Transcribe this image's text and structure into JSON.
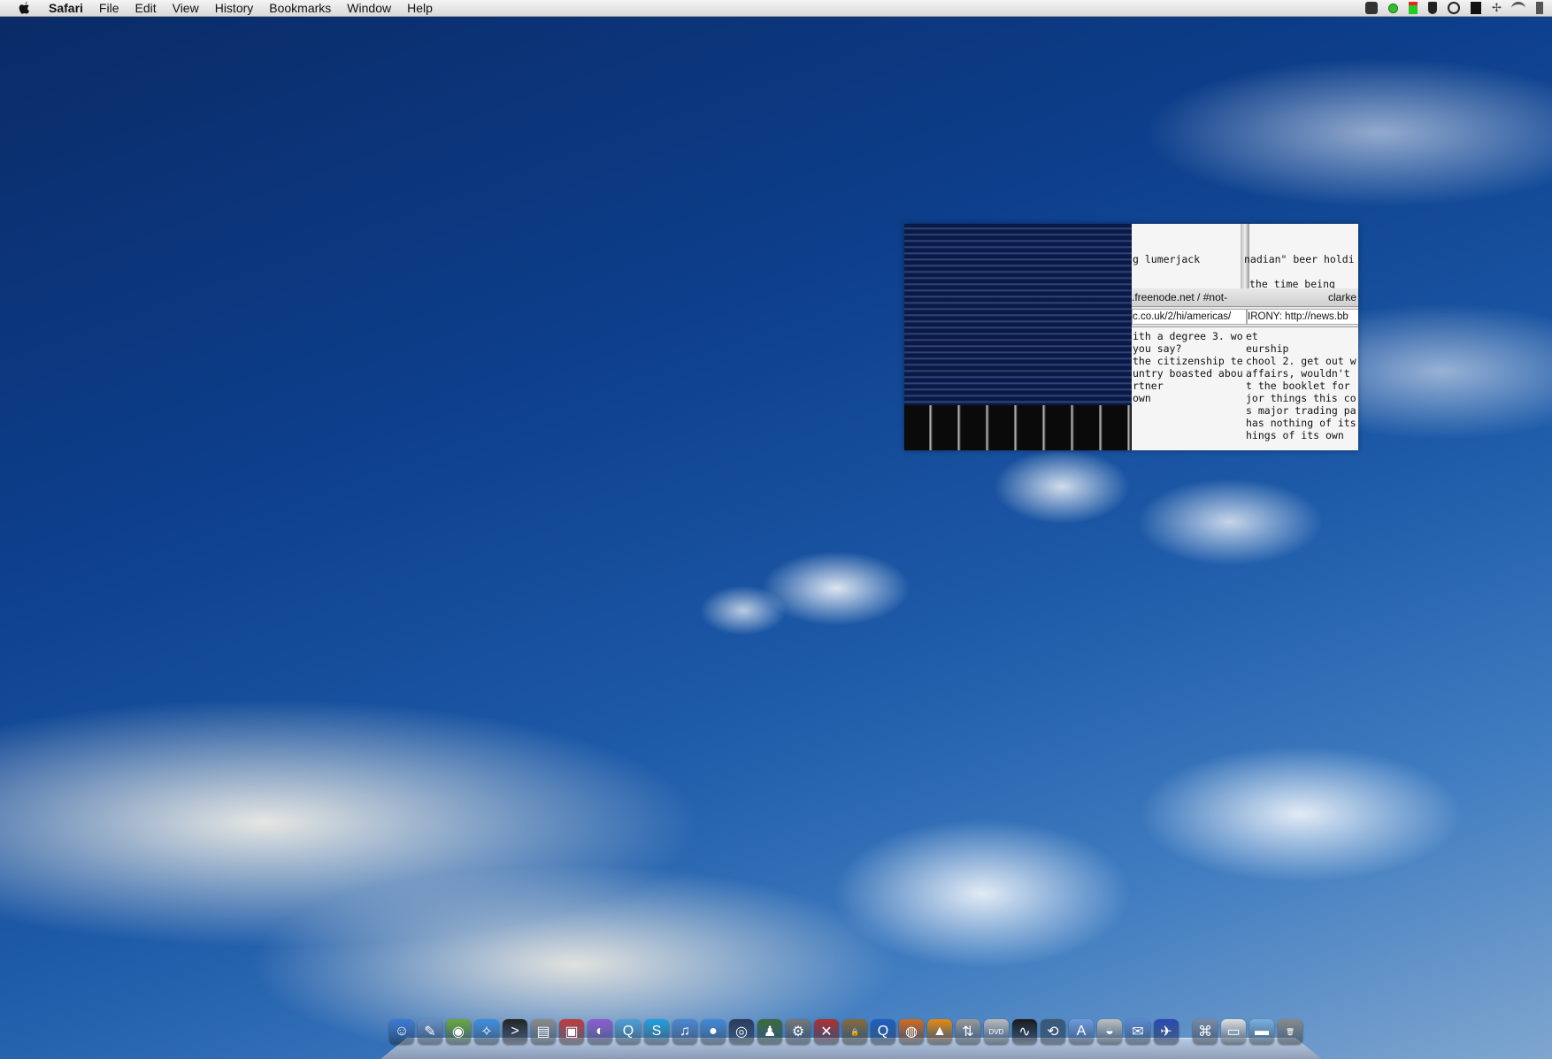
{
  "menubar": {
    "app_name": "Safari",
    "items": [
      "File",
      "Edit",
      "View",
      "History",
      "Bookmarks",
      "Window",
      "Help"
    ]
  },
  "status_icons": [
    "growl-icon",
    "green-dot-icon",
    "cpu-meter-icon",
    "plug-icon",
    "sync-icon",
    "clock-icon",
    "bluetooth-icon",
    "wifi-icon",
    "volume-icon"
  ],
  "fragment": {
    "terminal_lines_top": [
      "g lumerjack",
      "nadian\" beer holdi",
      "the time being"
    ],
    "tab_title_left": ".freenode.net / #not-",
    "tab_title_right": "clarke",
    "url_left": "c.co.uk/2/hi/americas/",
    "url_right": "IRONY: http://news.bb",
    "chat_left": [
      "",
      "",
      "ith a degree 3. wo",
      "you say?",
      "",
      "the citizenship te",
      "untry boasted abou",
      "rtner",
      "own"
    ],
    "chat_right": [
      "et",
      "eurship",
      "chool 2. get out w",
      "affairs, wouldn't",
      "",
      "t the booklet for",
      "jor things this co",
      "s major trading pa",
      "has nothing of its",
      "hings of its own"
    ]
  },
  "dock": {
    "apps": [
      {
        "name": "finder",
        "color": "#3b7bd6",
        "glyph": "☺"
      },
      {
        "name": "preview",
        "color": "#6a8fc4",
        "glyph": "✎"
      },
      {
        "name": "netnewswire",
        "color": "#6aa83a",
        "glyph": "◉"
      },
      {
        "name": "safari",
        "color": "#3d8fe0",
        "glyph": "✧"
      },
      {
        "name": "terminal",
        "color": "#222222",
        "glyph": ">"
      },
      {
        "name": "file-merge",
        "color": "#8a8a8a",
        "glyph": "▤"
      },
      {
        "name": "photo-booth",
        "color": "#c23a3a",
        "glyph": "▣"
      },
      {
        "name": "colloquy",
        "color": "#8c5bd6",
        "glyph": "◐"
      },
      {
        "name": "quicksilver",
        "color": "#4aa0d8",
        "glyph": "Q"
      },
      {
        "name": "skype",
        "color": "#1ea0e0",
        "glyph": "S"
      },
      {
        "name": "itunes",
        "color": "#4b86d2",
        "glyph": "♫"
      },
      {
        "name": "ichat",
        "color": "#3f8ad8",
        "glyph": "●"
      },
      {
        "name": "dashboard",
        "color": "#2a3a5a",
        "glyph": "◎"
      },
      {
        "name": "vlc-character",
        "color": "#3a6a3a",
        "glyph": "♟"
      },
      {
        "name": "system-preferences",
        "color": "#777777",
        "glyph": "⚙"
      },
      {
        "name": "x11",
        "color": "#b03030",
        "glyph": "✕"
      },
      {
        "name": "keychain",
        "color": "#8a6a3a",
        "glyph": "🔒"
      },
      {
        "name": "quicktime",
        "color": "#2060c0",
        "glyph": "Q"
      },
      {
        "name": "firefox",
        "color": "#d86a1a",
        "glyph": "◍"
      },
      {
        "name": "vlc",
        "color": "#e88a10",
        "glyph": "▲"
      },
      {
        "name": "transmission",
        "color": "#9a9a9a",
        "glyph": "⇅"
      },
      {
        "name": "dvd-player",
        "color": "#bbbbbb",
        "glyph": "DVD"
      },
      {
        "name": "activity-monitor",
        "color": "#1a1a1a",
        "glyph": "∿"
      },
      {
        "name": "time-machine",
        "color": "#3a5a7a",
        "glyph": "⟲"
      },
      {
        "name": "app-store-box",
        "color": "#6f9be0",
        "glyph": "A"
      },
      {
        "name": "cd-burner",
        "color": "#c0c0c0",
        "glyph": "◒"
      },
      {
        "name": "mail",
        "color": "#5a8ad0",
        "glyph": "✉"
      },
      {
        "name": "airplane",
        "color": "#2a4ab0",
        "glyph": "✈"
      }
    ],
    "right": [
      {
        "name": "network-folder",
        "color": "#7a8aa0",
        "glyph": "⌘"
      },
      {
        "name": "documents-stack",
        "color": "#e0e0e0",
        "glyph": "▭"
      },
      {
        "name": "downloads-folder",
        "color": "#7ab0e0",
        "glyph": "▬"
      },
      {
        "name": "trash",
        "color": "#8a8a8a",
        "glyph": "🗑"
      }
    ]
  }
}
